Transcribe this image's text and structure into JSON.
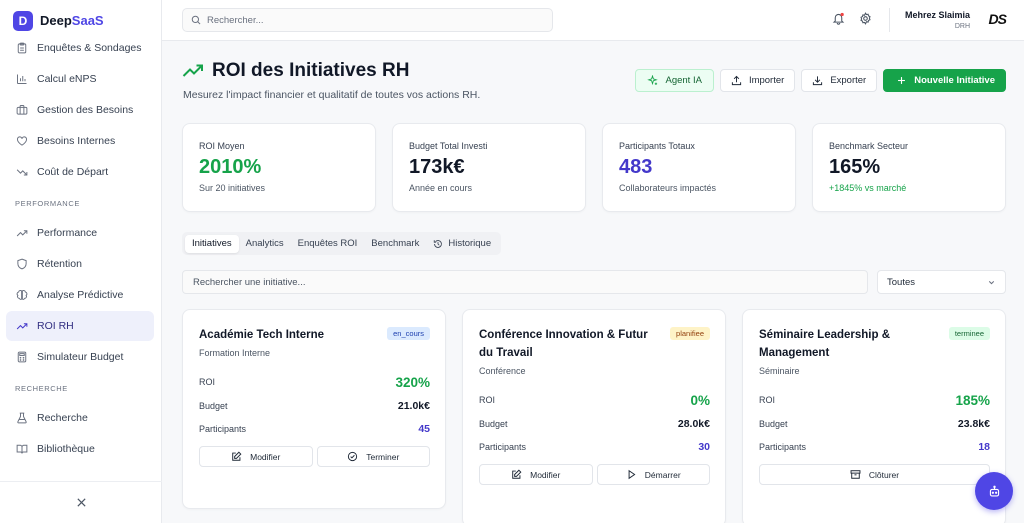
{
  "brand": {
    "logo_letter": "D",
    "name_part1": "Deep",
    "name_part2": "SaaS"
  },
  "sidebar": {
    "items_top": [
      {
        "label": "Enquêtes & Sondages",
        "icon": "clipboard-icon"
      },
      {
        "label": "Calcul eNPS",
        "icon": "bar-chart-icon"
      },
      {
        "label": "Gestion des Besoins",
        "icon": "briefcase-icon"
      },
      {
        "label": "Besoins Internes",
        "icon": "heart-icon"
      },
      {
        "label": "Coût de Départ",
        "icon": "trend-down-icon"
      }
    ],
    "section_performance": "PERFORMANCE",
    "items_performance": [
      {
        "label": "Performance",
        "icon": "trend-up-icon"
      },
      {
        "label": "Rétention",
        "icon": "shield-icon"
      },
      {
        "label": "Analyse Prédictive",
        "icon": "brain-icon"
      },
      {
        "label": "ROI RH",
        "icon": "trend-up-icon",
        "active": true
      },
      {
        "label": "Simulateur Budget",
        "icon": "calculator-icon"
      }
    ],
    "section_recherche": "RECHERCHE",
    "items_recherche": [
      {
        "label": "Recherche",
        "icon": "flask-icon"
      },
      {
        "label": "Bibliothèque",
        "icon": "book-icon"
      }
    ]
  },
  "topbar": {
    "search_placeholder": "Rechercher...",
    "user_name": "Mehrez Slaimia",
    "user_role": "DRH",
    "user_logo": "DS"
  },
  "page": {
    "title": "ROI des Initiatives RH",
    "subtitle": "Mesurez l'impact financier et qualitatif de toutes vos actions RH.",
    "actions": {
      "agent": "Agent IA",
      "import": "Importer",
      "export": "Exporter",
      "new": "Nouvelle Initiative"
    }
  },
  "stats": [
    {
      "label": "ROI Moyen",
      "value": "2010%",
      "note": "Sur 20 initiatives"
    },
    {
      "label": "Budget Total Investi",
      "value": "173k€",
      "note": "Année en cours"
    },
    {
      "label": "Participants Totaux",
      "value": "483",
      "note": "Collaborateurs impactés"
    },
    {
      "label": "Benchmark Secteur",
      "value": "165%",
      "note": "+1845% vs marché"
    }
  ],
  "tabs": [
    "Initiatives",
    "Analytics",
    "Enquêtes ROI",
    "Benchmark",
    "Historique"
  ],
  "filter": {
    "search_placeholder": "Rechercher une initiative...",
    "select_value": "Toutes"
  },
  "labels": {
    "roi": "ROI",
    "budget": "Budget",
    "participants": "Participants"
  },
  "cards": [
    {
      "title": "Académie Tech Interne",
      "status": "en_cours",
      "type": "Formation Interne",
      "roi": "320%",
      "budget": "21.0k€",
      "participants": "45",
      "btn1": "Modifier",
      "btn2": "Terminer"
    },
    {
      "title": "Conférence Innovation & Futur du Travail",
      "status": "planifiee",
      "type": "Conférence",
      "roi": "0%",
      "budget": "28.0k€",
      "participants": "30",
      "btn1": "Modifier",
      "btn2": "Démarrer"
    },
    {
      "title": "Séminaire Leadership & Management",
      "status": "terminee",
      "type": "Séminaire",
      "roi": "185%",
      "budget": "23.8k€",
      "participants": "18",
      "btn1": "Clôturer"
    }
  ],
  "colors": {
    "brand": "#4f46e5",
    "green": "#16a34a",
    "indigo": "#4338ca"
  }
}
